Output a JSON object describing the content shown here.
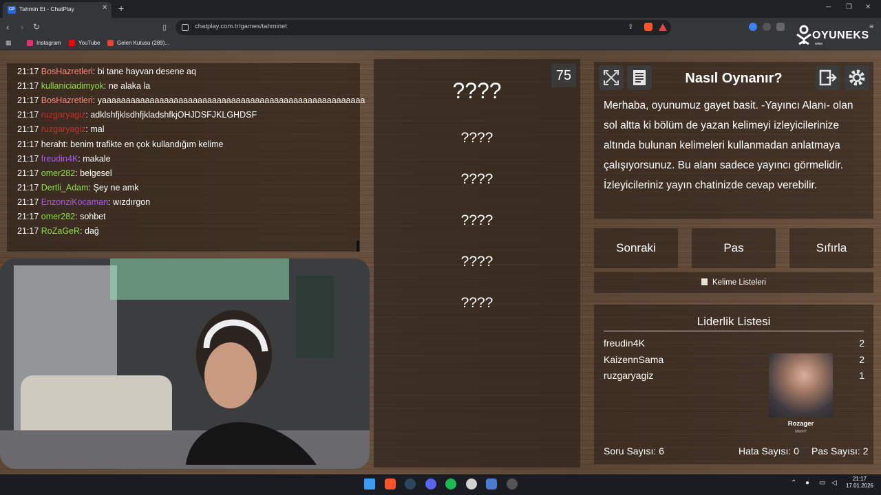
{
  "browser": {
    "tab_title": "Tahmin Et - ChatPlay",
    "tab_favicon_text": "CP",
    "new_tab": "+",
    "url": "chatplay.com.tr/games/tahminet",
    "bookmarks": [
      {
        "label": "Instagram",
        "color": "#e1306c"
      },
      {
        "label": "YouTube",
        "color": "#ff0000"
      },
      {
        "label": "Gelen Kutusu (289)...",
        "color": "#ea4335"
      }
    ]
  },
  "overlay": {
    "logo": "OYUNEKS",
    "logo_sub": "www"
  },
  "chat": {
    "name_colors": {
      "red": "#e05050",
      "green": "#8fe04a",
      "purple": "#a855f7",
      "muted": "#ff8a80",
      "default": "#ffffff"
    },
    "messages": [
      {
        "time": "21:17",
        "user": "BosHazretleri",
        "user_color": "#ff8a80",
        "text": "bi tane hayvan desene aq"
      },
      {
        "time": "21:17",
        "user": "kullaniciadimyok",
        "user_color": "#8fe04a",
        "text": "ne alaka la"
      },
      {
        "time": "21:17",
        "user": "BosHazretleri",
        "user_color": "#ff8a80",
        "text": "yaaaaaaaaaaaaaaaaaaaaaaaaaaaaaaaaaaaaaaaaaaaaaaaaaaaaaaa"
      },
      {
        "time": "21:17",
        "user": "ruzgaryagiz",
        "user_color": "#c2312e",
        "text": "adklshfjklsdhfjkladshfkjOHJDSFJKLGHDSF"
      },
      {
        "time": "21:17",
        "user": "ruzgaryagiz",
        "user_color": "#c2312e",
        "text": "mal"
      },
      {
        "time": "21:17",
        "user": "heraht",
        "user_color": "#ffffff",
        "text": "benim trafikte en çok kullandığım kelime"
      },
      {
        "time": "21:17",
        "user": "freudin4K",
        "user_color": "#a855f7",
        "text": "makale"
      },
      {
        "time": "21:17",
        "user": "omer282",
        "user_color": "#8fe04a",
        "text": "belgesel"
      },
      {
        "time": "21:17",
        "user": "Dertli_Adam",
        "user_color": "#8fe04a",
        "text": "Şey ne amk"
      },
      {
        "time": "21:17",
        "user": "EnzonziKocaman",
        "user_color": "#a855f7",
        "text": "wızdırgon"
      },
      {
        "time": "21:17",
        "user": "omer282",
        "user_color": "#8fe04a",
        "text": "sohbet"
      },
      {
        "time": "21:17",
        "user": "RoZaGeR",
        "user_color": "#8fe04a",
        "text": "dağ"
      }
    ]
  },
  "game": {
    "timer": "75",
    "main_word": "????",
    "taboo_words": [
      "????",
      "????",
      "????",
      "????",
      "????"
    ]
  },
  "howto": {
    "title": "Nasıl Oynanır?",
    "text": "Merhaba, oyunumuz gayet basit. -Yayıncı Alanı- olan sol altta ki bölüm de yazan kelimeyi izleyicilerinize altında bulunan kelimeleri kullanmadan anlatmaya çalışıyorsunuz. Bu alanı sadece yayıncı görmelidir. İzleyicileriniz yayın chatinizde cevap verebilir."
  },
  "controls": {
    "next": "Sonraki",
    "pass": "Pas",
    "reset": "Sıfırla",
    "word_lists": "Kelime Listeleri"
  },
  "leaderboard": {
    "title": "Liderlik Listesi",
    "rows": [
      {
        "name": "freudin4K",
        "score": "2"
      },
      {
        "name": "KaizennSama",
        "score": "2"
      },
      {
        "name": "ruzgaryagiz",
        "score": "1"
      }
    ],
    "streamer_name": "Rozager",
    "streamer_sub": "Mami?",
    "stats": {
      "questions": "Soru Sayısı: 6",
      "errors": "Hata Sayısı: 0",
      "passes": "Pas Sayısı: 2"
    }
  },
  "taskbar": {
    "time": "21:17",
    "date": "17.01.2026"
  }
}
